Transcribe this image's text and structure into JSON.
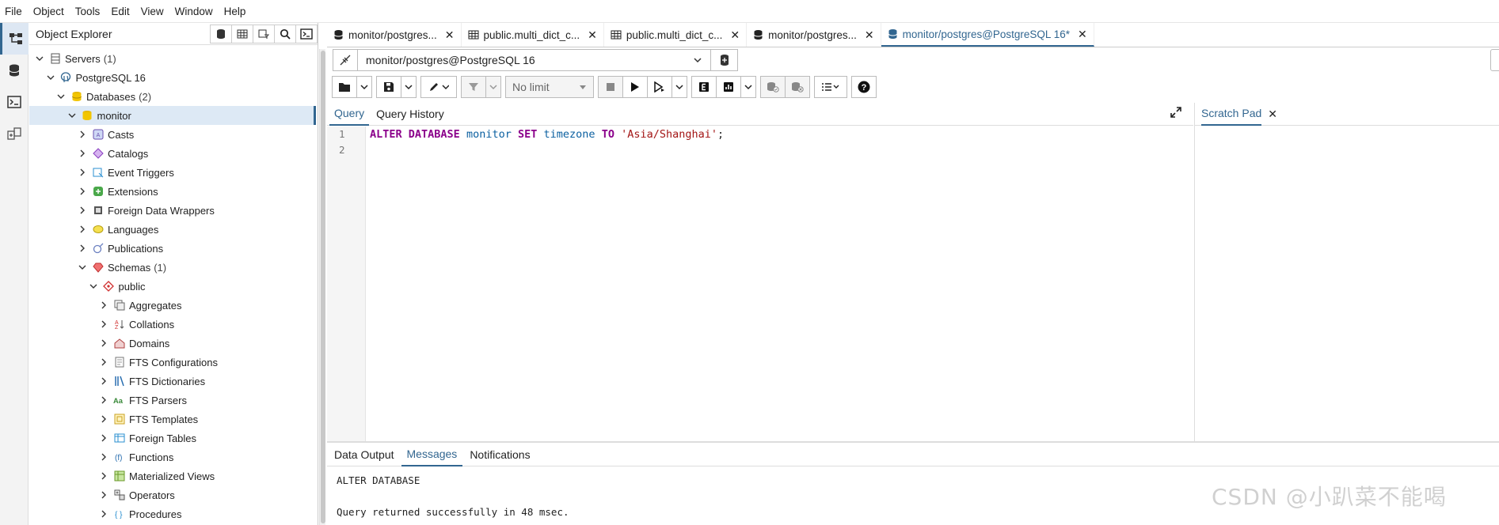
{
  "menu": [
    "File",
    "Object",
    "Tools",
    "Edit",
    "View",
    "Window",
    "Help"
  ],
  "explorer": {
    "title": "Object Explorer",
    "tree": [
      {
        "label": "Servers",
        "count": "(1)",
        "level": 0,
        "expanded": true,
        "icon": "servers-icon"
      },
      {
        "label": "PostgreSQL 16",
        "count": "",
        "level": 1,
        "expanded": true,
        "icon": "postgres-server-icon"
      },
      {
        "label": "Databases",
        "count": "(2)",
        "level": 2,
        "expanded": true,
        "icon": "databases-icon"
      },
      {
        "label": "monitor",
        "count": "",
        "level": 3,
        "expanded": true,
        "icon": "database-icon",
        "selected": true
      },
      {
        "label": "Casts",
        "count": "",
        "level": 4,
        "expanded": false,
        "icon": "casts-icon"
      },
      {
        "label": "Catalogs",
        "count": "",
        "level": 4,
        "expanded": false,
        "icon": "catalogs-icon"
      },
      {
        "label": "Event Triggers",
        "count": "",
        "level": 4,
        "expanded": false,
        "icon": "event-triggers-icon"
      },
      {
        "label": "Extensions",
        "count": "",
        "level": 4,
        "expanded": false,
        "icon": "extensions-icon"
      },
      {
        "label": "Foreign Data Wrappers",
        "count": "",
        "level": 4,
        "expanded": false,
        "icon": "foreign-data-wrappers-icon"
      },
      {
        "label": "Languages",
        "count": "",
        "level": 4,
        "expanded": false,
        "icon": "languages-icon"
      },
      {
        "label": "Publications",
        "count": "",
        "level": 4,
        "expanded": false,
        "icon": "publications-icon"
      },
      {
        "label": "Schemas",
        "count": "(1)",
        "level": 4,
        "expanded": true,
        "icon": "schemas-icon"
      },
      {
        "label": "public",
        "count": "",
        "level": 5,
        "expanded": true,
        "icon": "schema-icon"
      },
      {
        "label": "Aggregates",
        "count": "",
        "level": 6,
        "expanded": false,
        "icon": "aggregates-icon"
      },
      {
        "label": "Collations",
        "count": "",
        "level": 6,
        "expanded": false,
        "icon": "collations-icon"
      },
      {
        "label": "Domains",
        "count": "",
        "level": 6,
        "expanded": false,
        "icon": "domains-icon"
      },
      {
        "label": "FTS Configurations",
        "count": "",
        "level": 6,
        "expanded": false,
        "icon": "fts-configurations-icon"
      },
      {
        "label": "FTS Dictionaries",
        "count": "",
        "level": 6,
        "expanded": false,
        "icon": "fts-dictionaries-icon"
      },
      {
        "label": "FTS Parsers",
        "count": "",
        "level": 6,
        "expanded": false,
        "icon": "fts-parsers-icon"
      },
      {
        "label": "FTS Templates",
        "count": "",
        "level": 6,
        "expanded": false,
        "icon": "fts-templates-icon"
      },
      {
        "label": "Foreign Tables",
        "count": "",
        "level": 6,
        "expanded": false,
        "icon": "foreign-tables-icon"
      },
      {
        "label": "Functions",
        "count": "",
        "level": 6,
        "expanded": false,
        "icon": "functions-icon"
      },
      {
        "label": "Materialized Views",
        "count": "",
        "level": 6,
        "expanded": false,
        "icon": "materialized-views-icon"
      },
      {
        "label": "Operators",
        "count": "",
        "level": 6,
        "expanded": false,
        "icon": "operators-icon"
      },
      {
        "label": "Procedures",
        "count": "",
        "level": 6,
        "expanded": false,
        "icon": "procedures-icon"
      }
    ]
  },
  "tabs": [
    {
      "label": "monitor/postgres...",
      "icon": "query-tool-icon",
      "active": false
    },
    {
      "label": "public.multi_dict_c...",
      "icon": "table-icon",
      "active": false
    },
    {
      "label": "public.multi_dict_c...",
      "icon": "table-icon",
      "active": false
    },
    {
      "label": "monitor/postgres...",
      "icon": "query-tool-icon",
      "active": false
    },
    {
      "label": "monitor/postgres@PostgreSQL 16*",
      "icon": "query-tool-icon",
      "active": true
    }
  ],
  "connection": {
    "value": "monitor/postgres@PostgreSQL 16"
  },
  "toolbar": {
    "limit": "No limit"
  },
  "query_tabs": {
    "query": "Query",
    "history": "Query History"
  },
  "editor": {
    "line_numbers": [
      "1",
      "2"
    ],
    "tokens": [
      {
        "t": "ALTER",
        "c": "kw"
      },
      {
        "t": " ",
        "c": ""
      },
      {
        "t": "DATABASE",
        "c": "kw"
      },
      {
        "t": " ",
        "c": ""
      },
      {
        "t": "monitor",
        "c": "kw2"
      },
      {
        "t": " ",
        "c": ""
      },
      {
        "t": "SET",
        "c": "kw"
      },
      {
        "t": " ",
        "c": ""
      },
      {
        "t": "timezone",
        "c": "kw2"
      },
      {
        "t": " ",
        "c": ""
      },
      {
        "t": "TO",
        "c": "kw"
      },
      {
        "t": " ",
        "c": ""
      },
      {
        "t": "'Asia/Shanghai'",
        "c": "str"
      },
      {
        "t": ";",
        "c": ""
      }
    ]
  },
  "scratch": {
    "label": "Scratch Pad"
  },
  "results": {
    "tabs": [
      "Data Output",
      "Messages",
      "Notifications"
    ],
    "active": 1,
    "messages": [
      "ALTER DATABASE",
      "",
      "Query returned successfully in 48 msec."
    ]
  },
  "watermark": "CSDN @小趴菜不能喝",
  "colors": {
    "accent": "#326690",
    "selected_row": "#dde9f5"
  }
}
